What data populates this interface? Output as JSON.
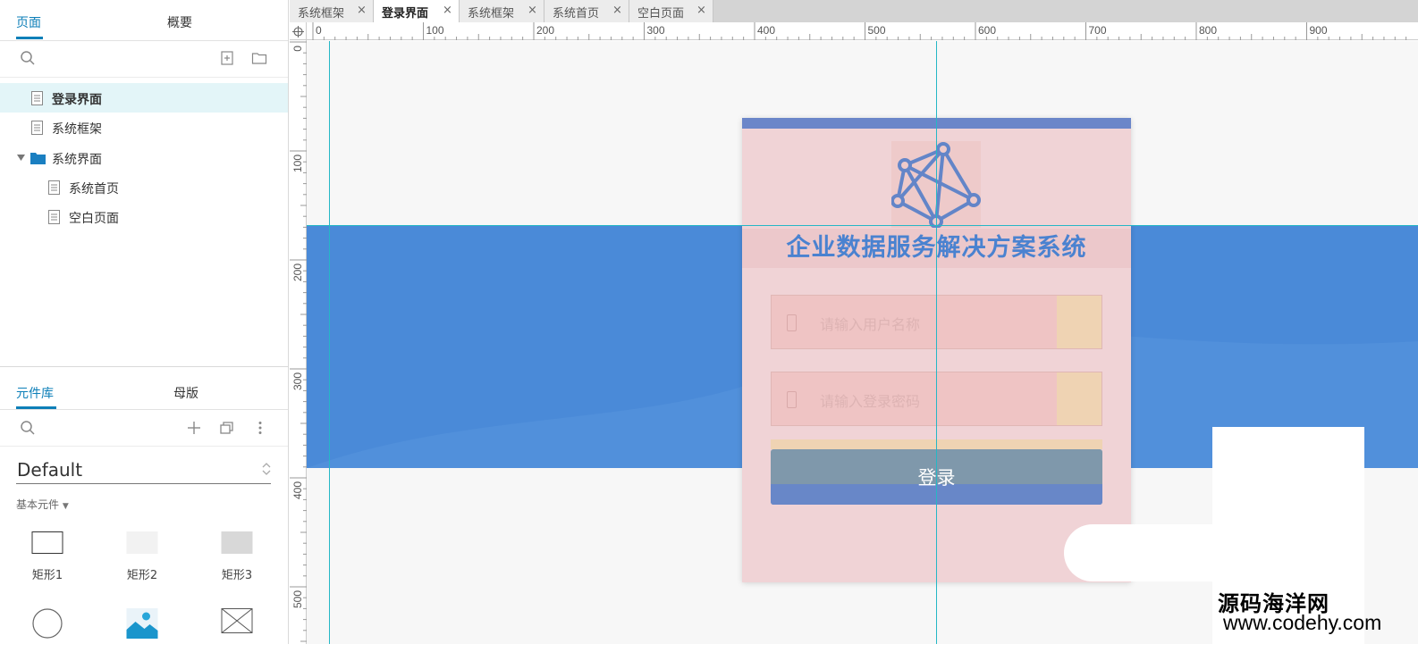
{
  "pages_panel": {
    "tabs": [
      "页面",
      "概要"
    ],
    "active_tab": 0,
    "tree": [
      {
        "label": "登录界面",
        "type": "page",
        "selected": true,
        "level": 0
      },
      {
        "label": "系统框架",
        "type": "page",
        "level": 0
      },
      {
        "label": "系统界面",
        "type": "folder",
        "expanded": true,
        "level": 0
      },
      {
        "label": "系统首页",
        "type": "page",
        "level": 1
      },
      {
        "label": "空白页面",
        "type": "page",
        "level": 1
      }
    ],
    "toolbar_icons": [
      "search-icon",
      "add-page-icon",
      "add-folder-icon"
    ]
  },
  "library_panel": {
    "tabs": [
      "元件库",
      "母版"
    ],
    "active_tab": 0,
    "toolbar_icons": [
      "search-icon",
      "plus-icon",
      "copy-icon",
      "more-icon"
    ],
    "selected_library": "Default",
    "section": "基本元件",
    "widgets": [
      {
        "label": "矩形1",
        "icon": "rectangle-outline-icon"
      },
      {
        "label": "矩形2",
        "icon": "rectangle-light-icon"
      },
      {
        "label": "矩形3",
        "icon": "rectangle-gray-icon"
      },
      {
        "label": "",
        "icon": "ellipse-icon"
      },
      {
        "label": "",
        "icon": "image-icon"
      },
      {
        "label": "",
        "icon": "placeholder-icon"
      }
    ]
  },
  "doc_tabs": [
    {
      "label": "系统框架",
      "active": false
    },
    {
      "label": "登录界面",
      "active": true
    },
    {
      "label": "系统框架",
      "active": false
    },
    {
      "label": "系统首页",
      "active": false
    },
    {
      "label": "空白页面",
      "active": false
    }
  ],
  "rulers": {
    "horizontal_labels": [
      "0",
      "100",
      "200",
      "300",
      "400",
      "500",
      "600",
      "700",
      "800",
      "900"
    ],
    "vertical_labels": [
      "0",
      "100",
      "200",
      "300",
      "400",
      "500"
    ]
  },
  "design": {
    "title": "企业数据服务解决方案系统",
    "username_placeholder": "请输入用户名称",
    "password_placeholder": "请输入登录密码",
    "login_button": "登录"
  },
  "colors": {
    "accent": "#0d7fb8",
    "band": "#4a8ad8",
    "guide": "#25b7c6",
    "card": "#f0d3d6"
  },
  "watermark": {
    "name": "源码海洋网",
    "url": "www.codehy.com"
  }
}
